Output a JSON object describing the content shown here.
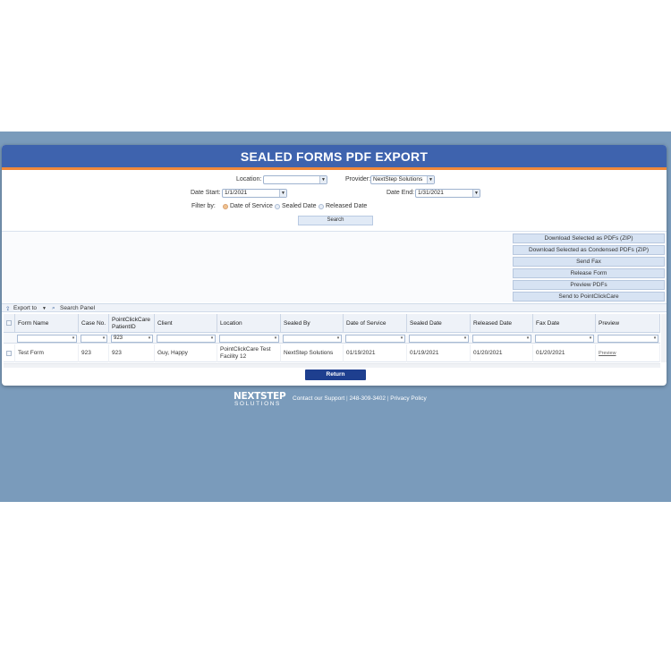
{
  "header": {
    "title": "SEALED FORMS PDF EXPORT"
  },
  "filters": {
    "location_label": "Location:",
    "location_value": "",
    "provider_label": "Provider:",
    "provider_value": "NextStep Solutions",
    "date_start_label": "Date Start:",
    "date_start_value": "1/1/2021",
    "date_end_label": "Date End:",
    "date_end_value": "1/31/2021",
    "filter_by_label": "Filter by:",
    "radio_options": [
      "Date of Service",
      "Sealed Date",
      "Released Date"
    ],
    "selected_radio": "Date of Service",
    "search_label": "Search"
  },
  "actions": [
    "Download Selected as PDFs (ZIP)",
    "Download Selected as Condensed PDFs (ZIP)",
    "Send Fax",
    "Release Form",
    "Preview PDFs",
    "Send to PointClickCare"
  ],
  "toolbar": {
    "export_label": "Export to",
    "search_panel_label": "Search Panel"
  },
  "table": {
    "columns": [
      "Form Name",
      "Case No.",
      "PointClickCare PatientID",
      "Client",
      "Location",
      "Sealed By",
      "Date of Service",
      "Sealed Date",
      "Released Date",
      "Fax Date",
      "Preview"
    ],
    "filter_values": [
      "",
      "",
      "923",
      "",
      "",
      "",
      "",
      "",
      "",
      "",
      ""
    ],
    "rows": [
      [
        "Test Form",
        "923",
        "923",
        "Guy, Happy",
        "PointClickCare Test Facility 12",
        "NextStep Solutions",
        "01/19/2021",
        "01/19/2021",
        "01/20/2021",
        "01/20/2021",
        "Preview"
      ]
    ]
  },
  "return_label": "Return",
  "footer": {
    "logo_line1": "NEXTSTEP",
    "logo_line2": "SOLUTIONS",
    "contact": "Contact our Support",
    "phone": "248-309-3402",
    "privacy": "Privacy Policy"
  },
  "colors": {
    "header_bg": "#3e63ae",
    "accent": "#f0883a",
    "page_bg": "#7a9bbb",
    "return_btn": "#1e3f8f"
  }
}
